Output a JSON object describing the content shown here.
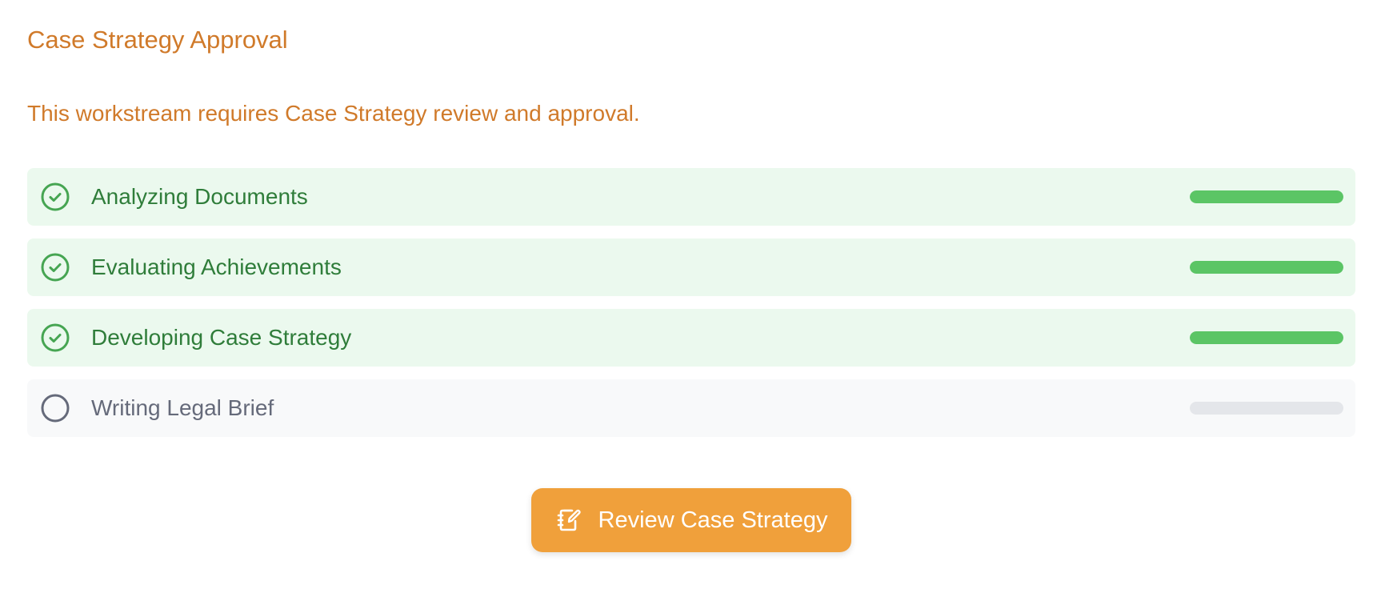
{
  "header": {
    "title": "Case Strategy Approval",
    "description": "This workstream requires Case Strategy review and approval."
  },
  "steps": [
    {
      "label": "Analyzing Documents",
      "status": "complete",
      "icon": "check-circle-icon",
      "progress": 1.0
    },
    {
      "label": "Evaluating Achievements",
      "status": "complete",
      "icon": "check-circle-icon",
      "progress": 1.0
    },
    {
      "label": "Developing Case Strategy",
      "status": "complete",
      "icon": "check-circle-icon",
      "progress": 1.0
    },
    {
      "label": "Writing Legal Brief",
      "status": "pending",
      "icon": "empty-circle-icon",
      "progress": 0.0
    }
  ],
  "action": {
    "label": "Review Case Strategy",
    "icon": "edit-notebook-icon"
  },
  "colors": {
    "accent": "#d07a2a",
    "button": "#f0a03b",
    "complete_bg": "#ebf9ee",
    "complete_text": "#2f7d3a",
    "complete_bar": "#5bc565",
    "pending_bg": "#f8f9fa",
    "pending_text": "#656a7a",
    "pending_bar": "#e4e6ea"
  }
}
